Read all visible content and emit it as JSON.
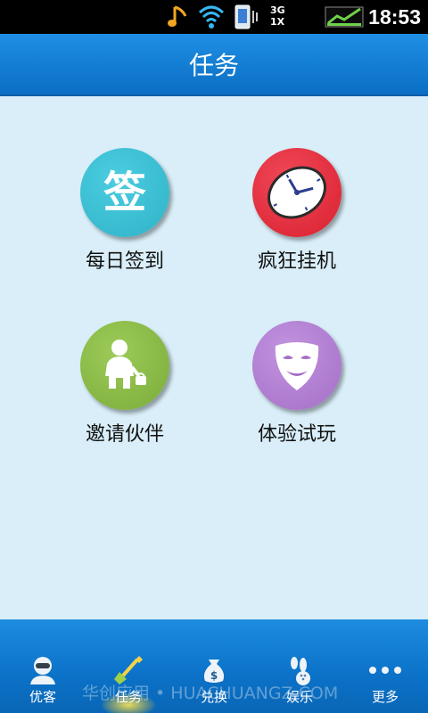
{
  "status_bar": {
    "network_label_top": "3G",
    "network_label_bottom": "1X",
    "time": "18:53",
    "icons": [
      "music-note-icon",
      "wifi-icon",
      "vibrate-icon",
      "signal-icon",
      "battery-icon"
    ]
  },
  "header": {
    "title": "任务"
  },
  "tasks": [
    {
      "label": "每日签到",
      "icon": "checkin-icon",
      "icon_text": "签",
      "color": "#38bcd1"
    },
    {
      "label": "疯狂挂机",
      "icon": "clock-icon",
      "color": "#e8303f"
    },
    {
      "label": "邀请伙伴",
      "icon": "person-icon",
      "color": "#8bb848"
    },
    {
      "label": "体验试玩",
      "icon": "mask-icon",
      "color": "#b07fd0"
    }
  ],
  "tabs": [
    {
      "label": "优客",
      "icon": "user-avatar-icon",
      "active": false
    },
    {
      "label": "任务",
      "icon": "shovel-icon",
      "active": true
    },
    {
      "label": "兑换",
      "icon": "money-bag-icon",
      "active": false
    },
    {
      "label": "娱乐",
      "icon": "bowling-icon",
      "active": false
    },
    {
      "label": "更多",
      "icon": "more-dots-icon",
      "active": false
    }
  ],
  "watermark": "华创应用 • HUACHUANGZ.COM",
  "colors": {
    "header_blue": "#0a6ec4",
    "content_bg": "#d9eef8",
    "tab_blue": "#0b72c8"
  }
}
